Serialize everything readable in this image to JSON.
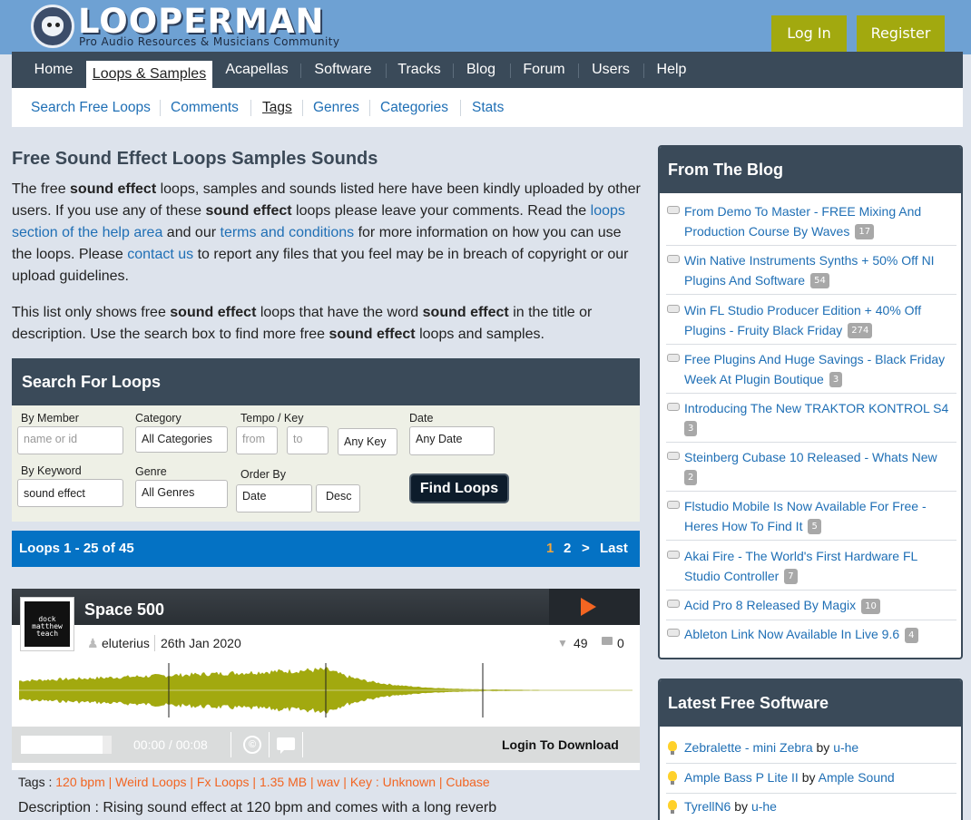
{
  "header": {
    "logo_text": "LOOPERMAN",
    "tagline": "Pro Audio Resources & Musicians Community",
    "login_label": "Log In",
    "register_label": "Register"
  },
  "nav": {
    "items": [
      "Home",
      "Loops & Samples",
      "Acapellas",
      "Software",
      "Tracks",
      "Blog",
      "Forum",
      "Users",
      "Help"
    ],
    "active": "Loops & Samples"
  },
  "subnav": {
    "items": [
      "Search Free Loops",
      "Comments",
      "Tags",
      "Genres",
      "Categories",
      "Stats"
    ],
    "active": "Tags"
  },
  "page": {
    "title": "Free Sound Effect Loops Samples Sounds",
    "p1": {
      "t1": "The free ",
      "b1": "sound effect",
      "t2": " loops, samples and sounds listed here have been kindly uploaded by other users. If you use any of these ",
      "b2": "sound effect",
      "t3": " loops please leave your comments. Read the ",
      "link1": "loops section of the help area",
      "t4": " and our ",
      "link2": "terms and conditions",
      "t5": " for more information on how you can use the loops. Please ",
      "link3": "contact us",
      "t6": " to report any files that you feel may be in breach of copyright or our upload guidelines."
    },
    "p2": {
      "t1": "This list only shows free ",
      "b1": "sound effect",
      "t2": " loops that have the word ",
      "b2": "sound effect",
      "t3": " in the title or description. Use the search box to find more free ",
      "b3": "sound effect",
      "t4": " loops and samples."
    }
  },
  "search": {
    "heading": "Search For Loops",
    "by_member_label": "By Member",
    "member_placeholder": "name or id",
    "category_label": "Category",
    "category_value": "All Categories",
    "tempo_key_label": "Tempo / Key",
    "tempo_from_placeholder": "from",
    "tempo_to_placeholder": "to",
    "key_value": "Any Key",
    "date_label": "Date",
    "date_value": "Any Date",
    "keyword_label": "By Keyword",
    "keyword_value": "sound effect",
    "genre_label": "Genre",
    "genre_value": "All Genres",
    "order_label": "Order By",
    "order_value": "Date",
    "order_dir": "Desc",
    "find_label": "Find Loops"
  },
  "pager": {
    "summary": "Loops 1 - 25 of 45",
    "page1": "1",
    "page2": "2",
    "next": ">",
    "last": "Last"
  },
  "loop": {
    "title": "Space 500",
    "avatar_text": "dock matthew teach",
    "user": "eluterius",
    "date": "26th Jan 2020",
    "downloads": "49",
    "comments": "0",
    "time": "00:00 / 00:08",
    "cc_symbol": "©",
    "download_label": "Login To Download",
    "tags_label": "Tags : ",
    "tags": [
      "120 bpm",
      "Weird Loops",
      "Fx Loops",
      "1.35 MB",
      "wav",
      "Key : Unknown",
      "Cubase"
    ],
    "description": "Description : Rising sound effect at 120 bpm and comes with a long reverb",
    "wave_color": "#a2a90f"
  },
  "blog": {
    "heading": "From The Blog",
    "items": [
      {
        "title": "From Demo To Master - FREE Mixing And Production Course By Waves",
        "count": "17"
      },
      {
        "title": "Win Native Instruments Synths + 50% Off NI Plugins And Software",
        "count": "54"
      },
      {
        "title": "Win FL Studio Producer Edition + 40% Off Plugins - Fruity Black Friday",
        "count": "274"
      },
      {
        "title": "Free Plugins And Huge Savings - Black Friday Week At Plugin Boutique",
        "count": "3"
      },
      {
        "title": "Introducing The New TRAKTOR KONTROL S4",
        "count": "3"
      },
      {
        "title": "Steinberg Cubase 10 Released - Whats New",
        "count": "2"
      },
      {
        "title": "Flstudio Mobile Is Now Available For Free - Heres How To Find It",
        "count": "5"
      },
      {
        "title": "Akai Fire - The World's First Hardware FL Studio Controller",
        "count": "7"
      },
      {
        "title": "Acid Pro 8 Released By Magix",
        "count": "10"
      },
      {
        "title": "Ableton Link Now Available In Live 9.6",
        "count": "4"
      }
    ]
  },
  "software": {
    "heading": "Latest Free Software",
    "items": [
      {
        "name": "Zebralette - mini Zebra",
        "by": "by",
        "author": "u-he"
      },
      {
        "name": "Ample Bass P Lite II",
        "by": "by",
        "author": "Ample Sound"
      },
      {
        "name": "TyrellN6",
        "by": "by",
        "author": "u-he"
      }
    ]
  },
  "colors": {
    "header_bg": "#6ea1d3",
    "nav_bg": "#3a4a59",
    "accent_olive": "#a2a90f",
    "pager_blue": "#0472c4",
    "tag_orange": "#f26522",
    "link_blue": "#1f6fb5"
  }
}
